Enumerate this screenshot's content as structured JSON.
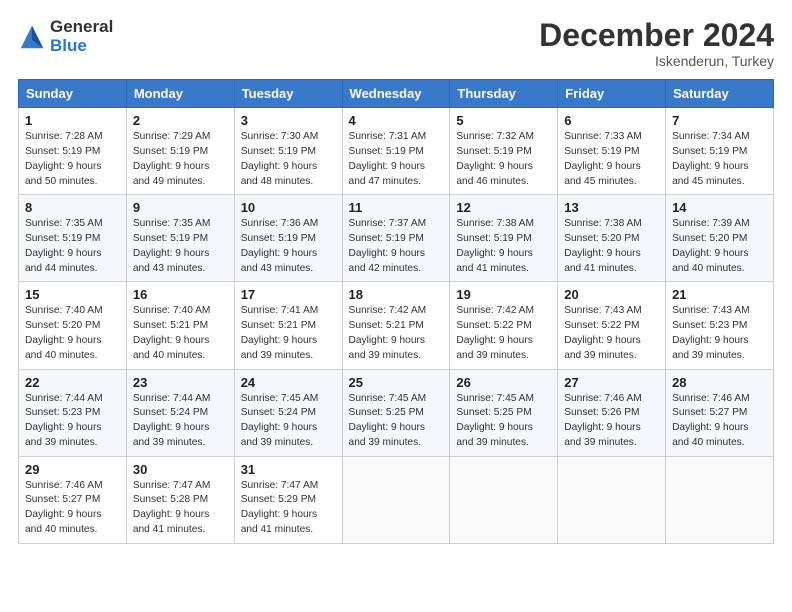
{
  "logo": {
    "general": "General",
    "blue": "Blue"
  },
  "title": "December 2024",
  "location": "Iskenderun, Turkey",
  "days_of_week": [
    "Sunday",
    "Monday",
    "Tuesday",
    "Wednesday",
    "Thursday",
    "Friday",
    "Saturday"
  ],
  "weeks": [
    [
      {
        "day": "1",
        "sunrise": "7:28 AM",
        "sunset": "5:19 PM",
        "daylight": "9 hours and 50 minutes."
      },
      {
        "day": "2",
        "sunrise": "7:29 AM",
        "sunset": "5:19 PM",
        "daylight": "9 hours and 49 minutes."
      },
      {
        "day": "3",
        "sunrise": "7:30 AM",
        "sunset": "5:19 PM",
        "daylight": "9 hours and 48 minutes."
      },
      {
        "day": "4",
        "sunrise": "7:31 AM",
        "sunset": "5:19 PM",
        "daylight": "9 hours and 47 minutes."
      },
      {
        "day": "5",
        "sunrise": "7:32 AM",
        "sunset": "5:19 PM",
        "daylight": "9 hours and 46 minutes."
      },
      {
        "day": "6",
        "sunrise": "7:33 AM",
        "sunset": "5:19 PM",
        "daylight": "9 hours and 45 minutes."
      },
      {
        "day": "7",
        "sunrise": "7:34 AM",
        "sunset": "5:19 PM",
        "daylight": "9 hours and 45 minutes."
      }
    ],
    [
      {
        "day": "8",
        "sunrise": "7:35 AM",
        "sunset": "5:19 PM",
        "daylight": "9 hours and 44 minutes."
      },
      {
        "day": "9",
        "sunrise": "7:35 AM",
        "sunset": "5:19 PM",
        "daylight": "9 hours and 43 minutes."
      },
      {
        "day": "10",
        "sunrise": "7:36 AM",
        "sunset": "5:19 PM",
        "daylight": "9 hours and 43 minutes."
      },
      {
        "day": "11",
        "sunrise": "7:37 AM",
        "sunset": "5:19 PM",
        "daylight": "9 hours and 42 minutes."
      },
      {
        "day": "12",
        "sunrise": "7:38 AM",
        "sunset": "5:19 PM",
        "daylight": "9 hours and 41 minutes."
      },
      {
        "day": "13",
        "sunrise": "7:38 AM",
        "sunset": "5:20 PM",
        "daylight": "9 hours and 41 minutes."
      },
      {
        "day": "14",
        "sunrise": "7:39 AM",
        "sunset": "5:20 PM",
        "daylight": "9 hours and 40 minutes."
      }
    ],
    [
      {
        "day": "15",
        "sunrise": "7:40 AM",
        "sunset": "5:20 PM",
        "daylight": "9 hours and 40 minutes."
      },
      {
        "day": "16",
        "sunrise": "7:40 AM",
        "sunset": "5:21 PM",
        "daylight": "9 hours and 40 minutes."
      },
      {
        "day": "17",
        "sunrise": "7:41 AM",
        "sunset": "5:21 PM",
        "daylight": "9 hours and 39 minutes."
      },
      {
        "day": "18",
        "sunrise": "7:42 AM",
        "sunset": "5:21 PM",
        "daylight": "9 hours and 39 minutes."
      },
      {
        "day": "19",
        "sunrise": "7:42 AM",
        "sunset": "5:22 PM",
        "daylight": "9 hours and 39 minutes."
      },
      {
        "day": "20",
        "sunrise": "7:43 AM",
        "sunset": "5:22 PM",
        "daylight": "9 hours and 39 minutes."
      },
      {
        "day": "21",
        "sunrise": "7:43 AM",
        "sunset": "5:23 PM",
        "daylight": "9 hours and 39 minutes."
      }
    ],
    [
      {
        "day": "22",
        "sunrise": "7:44 AM",
        "sunset": "5:23 PM",
        "daylight": "9 hours and 39 minutes."
      },
      {
        "day": "23",
        "sunrise": "7:44 AM",
        "sunset": "5:24 PM",
        "daylight": "9 hours and 39 minutes."
      },
      {
        "day": "24",
        "sunrise": "7:45 AM",
        "sunset": "5:24 PM",
        "daylight": "9 hours and 39 minutes."
      },
      {
        "day": "25",
        "sunrise": "7:45 AM",
        "sunset": "5:25 PM",
        "daylight": "9 hours and 39 minutes."
      },
      {
        "day": "26",
        "sunrise": "7:45 AM",
        "sunset": "5:25 PM",
        "daylight": "9 hours and 39 minutes."
      },
      {
        "day": "27",
        "sunrise": "7:46 AM",
        "sunset": "5:26 PM",
        "daylight": "9 hours and 39 minutes."
      },
      {
        "day": "28",
        "sunrise": "7:46 AM",
        "sunset": "5:27 PM",
        "daylight": "9 hours and 40 minutes."
      }
    ],
    [
      {
        "day": "29",
        "sunrise": "7:46 AM",
        "sunset": "5:27 PM",
        "daylight": "9 hours and 40 minutes."
      },
      {
        "day": "30",
        "sunrise": "7:47 AM",
        "sunset": "5:28 PM",
        "daylight": "9 hours and 41 minutes."
      },
      {
        "day": "31",
        "sunrise": "7:47 AM",
        "sunset": "5:29 PM",
        "daylight": "9 hours and 41 minutes."
      },
      null,
      null,
      null,
      null
    ]
  ],
  "labels": {
    "sunrise": "Sunrise:",
    "sunset": "Sunset:",
    "daylight": "Daylight:"
  }
}
